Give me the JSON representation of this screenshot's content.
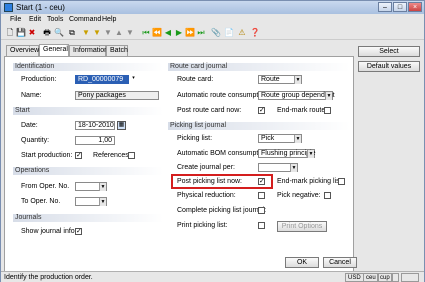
{
  "window": {
    "title": "Start (1 - ceu)"
  },
  "menu": [
    "File",
    "Edit",
    "Tools",
    "Command",
    "Help"
  ],
  "tabs": [
    "Overview",
    "General",
    "Information",
    "Batch"
  ],
  "sections": {
    "identification": "Identification",
    "start": "Start",
    "operations": "Operations",
    "journals": "Journals",
    "route_card_journal": "Route card journal",
    "picking_list_journal": "Picking list journal"
  },
  "identification": {
    "production_label": "Production:",
    "production_value": "RD_00000079",
    "name_label": "Name:",
    "name_value": "Pony packages"
  },
  "start": {
    "date_label": "Date:",
    "date_value": "18-10-2010",
    "quantity_label": "Quantity:",
    "quantity_value": "1,00",
    "start_production_label": "Start production:",
    "start_production_checked": true,
    "references_label": "References:",
    "references_checked": false
  },
  "operations": {
    "from_label": "From Oper. No.",
    "to_label": "To Oper. No."
  },
  "journals": {
    "show_info_label": "Show journal info:",
    "show_info_checked": true
  },
  "route_card": {
    "route_card_label": "Route card:",
    "route_card_value": "Route",
    "auto_consumption_label": "Automatic route consumption:",
    "auto_consumption_value": "Route group dependent",
    "post_now_label": "Post route card now:",
    "post_now_checked": true,
    "end_mark_label": "End-mark route:",
    "end_mark_checked": false
  },
  "picking_list": {
    "picking_list_label": "Picking list:",
    "picking_list_value": "Pick",
    "auto_bom_label": "Automatic BOM consumption:",
    "auto_bom_value": "Flushing principle",
    "create_journal_label": "Create journal per:",
    "create_journal_value": "",
    "post_now_label": "Post picking list now:",
    "post_now_checked": true,
    "end_mark_label": "End-mark picking list:",
    "end_mark_checked": false,
    "physical_reduction_label": "Physical reduction:",
    "pick_negative_label": "Pick negative:",
    "complete_journal_label": "Complete picking list journal:",
    "print_label": "Print picking list:",
    "print_options_button": "Print Options"
  },
  "side_buttons": {
    "select": "Select",
    "default_values": "Default values"
  },
  "footer_buttons": {
    "ok": "OK",
    "cancel": "Cancel"
  },
  "status": {
    "message": "Identify the production order.",
    "currency": "USD",
    "company": "ceu",
    "layer": "cup"
  }
}
